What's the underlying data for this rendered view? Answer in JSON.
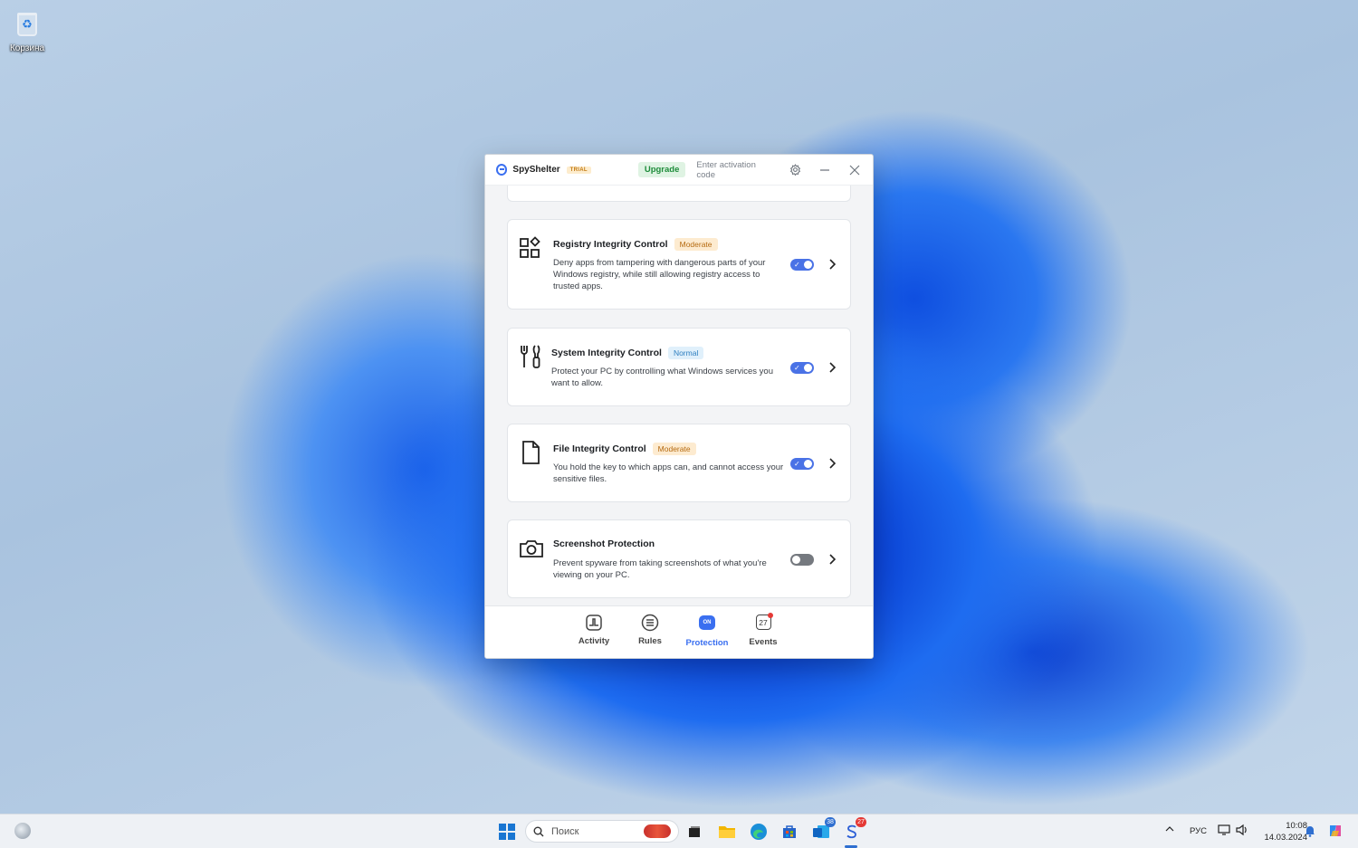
{
  "desktop": {
    "recycle_bin_label": "Корзина"
  },
  "window": {
    "app_name": "SpyShelter",
    "trial_badge": "TRIAL",
    "upgrade_label": "Upgrade",
    "activation_label": "Enter activation code"
  },
  "cards": [
    {
      "title": "Registry Integrity Control",
      "badge": "Moderate",
      "badge_type": "moderate",
      "description": "Deny apps from tampering with dangerous parts of your Windows registry, while still allowing registry access to trusted apps.",
      "enabled": true,
      "icon": "registry-blocks-icon"
    },
    {
      "title": "System Integrity Control",
      "badge": "Normal",
      "badge_type": "normal",
      "description": "Protect your PC by controlling what Windows services you want to allow.",
      "enabled": true,
      "icon": "tools-icon"
    },
    {
      "title": "File Integrity Control",
      "badge": "Moderate",
      "badge_type": "moderate",
      "description": "You hold the key to which apps can, and cannot access your sensitive files.",
      "enabled": true,
      "icon": "file-icon"
    },
    {
      "title": "Screenshot Protection",
      "badge": "",
      "badge_type": "",
      "description": "Prevent spyware from taking screenshots of what you're viewing on your PC.",
      "enabled": false,
      "icon": "camera-icon"
    }
  ],
  "nav": {
    "activity": "Activity",
    "rules": "Rules",
    "protection": "Protection",
    "protection_pill": "ON",
    "events": "Events",
    "events_count": "27",
    "active": "protection"
  },
  "taskbar": {
    "search_placeholder": "Поиск",
    "outlook_badge": "38",
    "spyshelter_badge": "27",
    "language": "РУС",
    "time": "10:08",
    "date": "14.03.2024"
  },
  "colors": {
    "accent": "#3a6ff0",
    "toggle_on": "#4a72e6",
    "moderate": "#b56a10",
    "normal": "#2f7fc0",
    "upgrade": "#1e8c3a"
  }
}
